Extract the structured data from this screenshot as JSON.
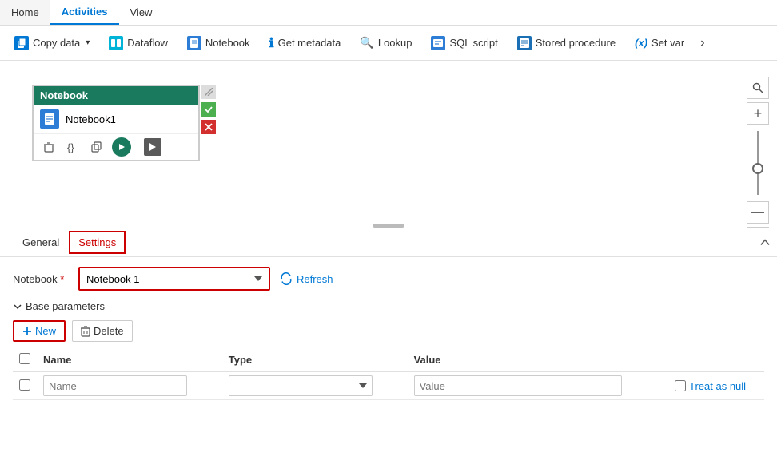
{
  "topNav": {
    "items": [
      {
        "label": "Home",
        "active": false
      },
      {
        "label": "Activities",
        "active": true
      },
      {
        "label": "View",
        "active": false
      }
    ]
  },
  "toolbar": {
    "buttons": [
      {
        "label": "Copy data",
        "icon": "copy-icon",
        "hasChevron": true
      },
      {
        "label": "Dataflow",
        "icon": "dataflow-icon",
        "hasChevron": false
      },
      {
        "label": "Notebook",
        "icon": "notebook-icon",
        "hasChevron": false
      },
      {
        "label": "Get metadata",
        "icon": "metadata-icon",
        "hasChevron": false
      },
      {
        "label": "Lookup",
        "icon": "lookup-icon",
        "hasChevron": false
      },
      {
        "label": "SQL script",
        "icon": "sqlscript-icon",
        "hasChevron": false
      },
      {
        "label": "Stored procedure",
        "icon": "storedproc-icon",
        "hasChevron": false
      },
      {
        "label": "Set var",
        "icon": "setvar-icon",
        "hasChevron": false
      }
    ]
  },
  "canvas": {
    "node": {
      "title": "Notebook",
      "item_label": "Notebook1"
    },
    "zoom": {
      "search_title": "Search",
      "plus_title": "Zoom in",
      "minus_title": "Zoom out",
      "fit_title": "Fit to screen"
    }
  },
  "bottomPanel": {
    "tabs": [
      {
        "label": "General",
        "active": false
      },
      {
        "label": "Settings",
        "active": true
      }
    ],
    "collapse_title": "Collapse",
    "settings": {
      "notebook_label": "Notebook",
      "notebook_required": "*",
      "notebook_value": "Notebook 1",
      "notebook_placeholder": "Notebook 1",
      "refresh_label": "Refresh",
      "base_params_label": "Base parameters",
      "new_btn_label": "New",
      "delete_btn_label": "Delete",
      "table": {
        "columns": [
          "",
          "Name",
          "Type",
          "Value",
          ""
        ],
        "row": {
          "name_placeholder": "Name",
          "type_placeholder": "",
          "value_placeholder": "Value",
          "treat_as_null": "Treat as null"
        }
      }
    }
  }
}
